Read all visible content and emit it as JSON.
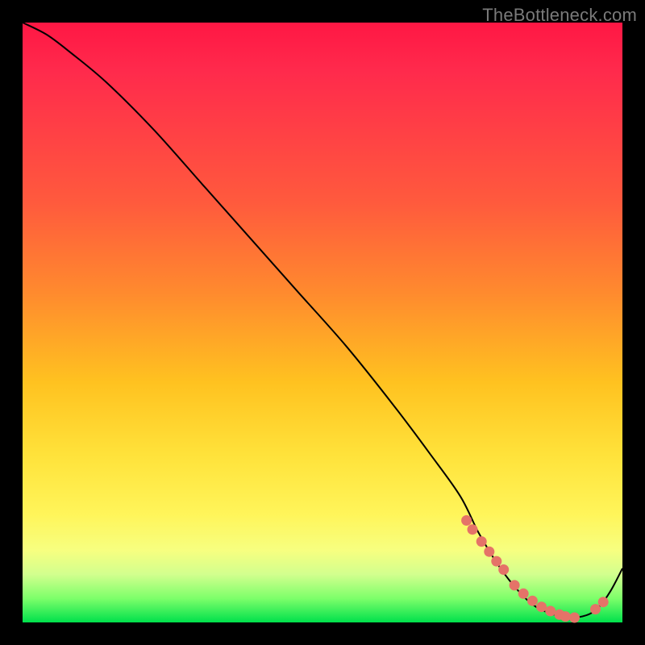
{
  "watermark": "TheBottleneck.com",
  "chart_data": {
    "type": "line",
    "title": "",
    "xlabel": "",
    "ylabel": "",
    "xlim": [
      0,
      100
    ],
    "ylim": [
      0,
      100
    ],
    "series": [
      {
        "name": "curve",
        "x": [
          0,
          4,
          8,
          14,
          22,
          30,
          38,
          46,
          54,
          62,
          68,
          73,
          76,
          79,
          82,
          85,
          88,
          91,
          94,
          96,
          98,
          100
        ],
        "values": [
          100,
          98,
          95,
          90,
          82,
          73,
          64,
          55,
          46,
          36,
          28,
          21,
          15,
          10,
          6,
          3,
          1.5,
          0.8,
          1.2,
          2.5,
          5.2,
          9.0
        ]
      }
    ],
    "markers": {
      "name": "highlighted-points",
      "color": "#e57368",
      "x": [
        74,
        75,
        76.5,
        77.8,
        79.0,
        80.2,
        82.0,
        83.5,
        85.0,
        86.5,
        88.0,
        89.5,
        90.5,
        92.0,
        95.5,
        96.8
      ],
      "values": [
        17,
        15.5,
        13.5,
        11.8,
        10.2,
        8.8,
        6.2,
        4.8,
        3.6,
        2.6,
        1.9,
        1.3,
        1.0,
        0.8,
        2.2,
        3.4
      ]
    },
    "background_gradient": {
      "top": "#ff1744",
      "mid1": "#ff8a2e",
      "mid2": "#ffe23a",
      "bottom": "#00e04c"
    }
  }
}
